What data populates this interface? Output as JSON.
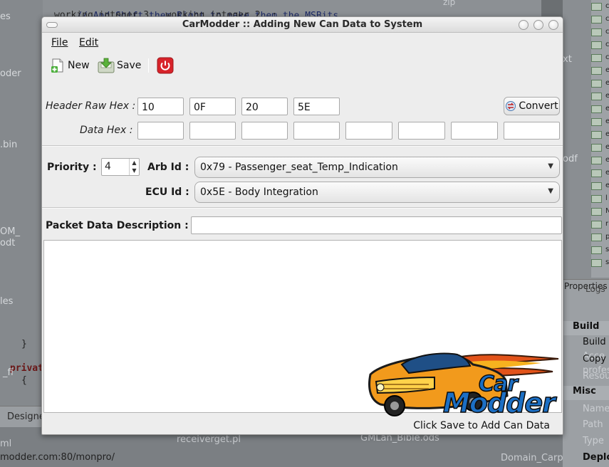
{
  "background": {
    "code_line1": "// And Shift them Right to make them the MSBits...",
    "code_line2": "working integer 3   working integer 2 .:",
    "left_labels": [
      "es",
      "oder",
      ".bin",
      "OM_",
      "odt",
      "les"
    ],
    "left_code": [
      "}",
      "privat",
      "{"
    ],
    "left_fi": "_fi",
    "designer_tab": "Designe",
    "status_url": "modder.com:80/monpro/",
    "status_file1": "receiverget.pl",
    "status_file2": "GMLan_Bible.ods",
    "status_file3": "Domain_Carpa",
    "status_file4": "ml",
    "right_zip": "zip",
    "right_xt": "xt",
    "right_odf": "odf",
    "right_letters": [
      "c",
      "c",
      "c",
      "c",
      "c",
      "e",
      "e",
      "e",
      "e",
      "e",
      "e",
      "e",
      "e",
      "e",
      "e",
      "l",
      "N",
      "r",
      "p",
      "s",
      "s"
    ],
    "properties_title": "Properties",
    "properties_tab2": "Logs",
    "prop_build_section": "Build",
    "prop_build": "Build",
    "prop_copy": "Copy",
    "prop_resou": "Resou",
    "prop_acce": "Acce",
    "prop_profession": "profession",
    "prop_misc_section": "Misc",
    "prop_name": "Name",
    "prop_path": "Path",
    "prop_type": "Type",
    "prop_deploy": "Deploy"
  },
  "window": {
    "title": "CarModder :: Adding New Can Data to System"
  },
  "menu": {
    "file": "File",
    "edit": "Edit"
  },
  "toolbar": {
    "new_label": "New",
    "save_label": "Save"
  },
  "form": {
    "header_raw_hex_label": "Header Raw Hex :",
    "header_hex": [
      "10",
      "0F",
      "20",
      "5E"
    ],
    "convert_label": "Convert",
    "data_hex_label": "Data Hex :",
    "data_hex": [
      "",
      "",
      "",
      "",
      "",
      "",
      "",
      ""
    ],
    "priority_label": "Priority :",
    "priority_value": "4",
    "arb_id_label": "Arb Id :",
    "arb_id_value": "0x79 - Passenger_seat_Temp_Indication",
    "ecu_id_label": "ECU Id :",
    "ecu_id_value": "0x5E - Body Integration",
    "packet_desc_label": "Packet Data Description :",
    "packet_desc_value": "",
    "notes_value": ""
  },
  "logo": {
    "line1": "Car",
    "line2": "Modder"
  },
  "status": {
    "text": "Click Save to Add Can Data"
  },
  "colors": {
    "logo_orange": "#f29a1c",
    "logo_blue": "#1c6fc4",
    "power_red": "#d8232a"
  }
}
